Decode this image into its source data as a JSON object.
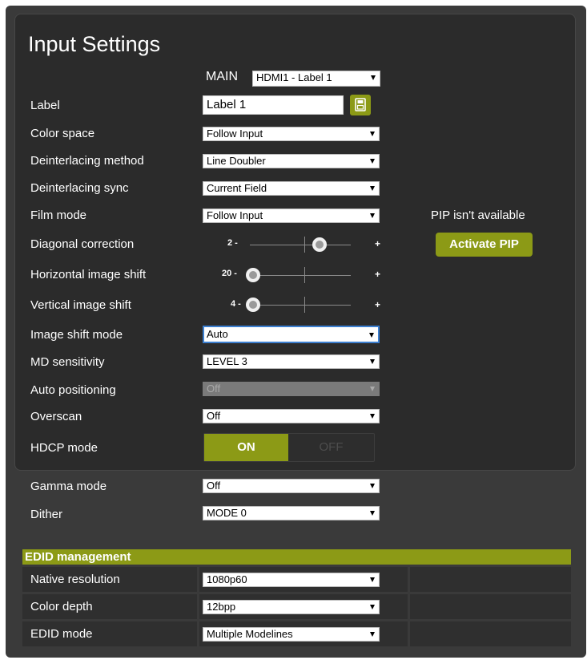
{
  "page": {
    "title": "Input Settings"
  },
  "main": {
    "label": "MAIN",
    "selected": "HDMI1 - Label 1"
  },
  "fields": {
    "label": {
      "label": "Label",
      "value": "Label 1"
    },
    "color_space": {
      "label": "Color space",
      "value": "Follow Input"
    },
    "deinterlacing_method": {
      "label": "Deinterlacing method",
      "value": "Line Doubler"
    },
    "deinterlacing_sync": {
      "label": "Deinterlacing sync",
      "value": "Current Field"
    },
    "film_mode": {
      "label": "Film mode",
      "value": "Follow Input"
    },
    "diagonal_correction": {
      "label": "Diagonal correction",
      "min_label": "2 -",
      "max_label": "+",
      "level": 0.7
    },
    "horizontal_image_shift": {
      "label": "Horizontal image shift",
      "min_label": "20 -",
      "max_label": "+",
      "level": 0
    },
    "vertical_image_shift": {
      "label": "Vertical image shift",
      "min_label": "4 -",
      "max_label": "+",
      "level": 0
    },
    "image_shift_mode": {
      "label": "Image shift mode",
      "value": "Auto"
    },
    "md_sensitivity": {
      "label": "MD sensitivity",
      "value": "LEVEL 3"
    },
    "auto_positioning": {
      "label": "Auto positioning",
      "value": "Off"
    },
    "overscan": {
      "label": "Overscan",
      "value": "Off"
    },
    "hdcp_mode": {
      "label": "HDCP mode",
      "on_label": "ON",
      "off_label": "OFF",
      "state": "ON"
    },
    "gamma_mode": {
      "label": "Gamma mode",
      "value": "Off"
    },
    "dither": {
      "label": "Dither",
      "value": "MODE 0"
    }
  },
  "pip": {
    "status": "PIP isn't available",
    "button": "Activate PIP"
  },
  "edid": {
    "title": "EDID management",
    "rows": [
      {
        "label": "Native resolution",
        "value": "1080p60"
      },
      {
        "label": "Color depth",
        "value": "12bpp"
      },
      {
        "label": "EDID mode",
        "value": "Multiple Modelines"
      }
    ]
  },
  "colors": {
    "accent": "#8c9a16",
    "background": "#3a3a3a",
    "panel": "#2b2b2b"
  },
  "icons": {
    "save": "save-icon",
    "dropdown": "chevron-down-icon"
  }
}
